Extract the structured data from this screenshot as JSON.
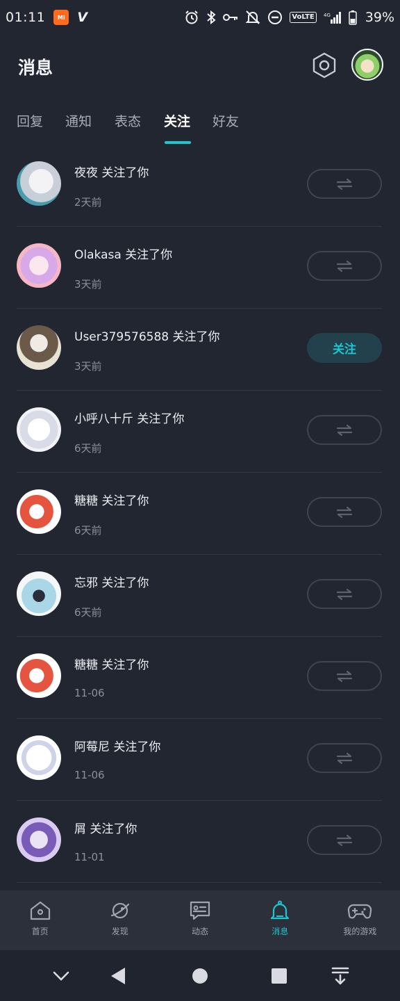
{
  "status_bar": {
    "time": "01:11",
    "app_badge": "Mi",
    "volte": "VoLTE",
    "network": "4G",
    "battery": "39%"
  },
  "header": {
    "title": "消息"
  },
  "tabs": [
    {
      "label": "回复"
    },
    {
      "label": "通知"
    },
    {
      "label": "表态"
    },
    {
      "label": "关注",
      "active": true
    },
    {
      "label": "好友"
    }
  ],
  "notifications": [
    {
      "name": "夜夜 关注了你",
      "time": "2天前",
      "button": "mutual",
      "avatar_color": "#c9cfd9"
    },
    {
      "name": "Olakasa 关注了你",
      "time": "3天前",
      "button": "mutual",
      "avatar_color": "#d8a9e8"
    },
    {
      "name": "User379576588 关注了你",
      "time": "3天前",
      "button": "follow",
      "button_label": "关注",
      "avatar_color": "#6b5a4a"
    },
    {
      "name": "小呼八十斤 关注了你",
      "time": "6天前",
      "button": "mutual",
      "avatar_color": "#e7e8f0"
    },
    {
      "name": "糖糖 关注了你",
      "time": "6天前",
      "button": "mutual",
      "avatar_color": "#e4543f"
    },
    {
      "name": "忘邪 关注了你",
      "time": "6天前",
      "button": "mutual",
      "avatar_color": "#a9d7e8"
    },
    {
      "name": "糖糖 关注了你",
      "time": "11-06",
      "button": "mutual",
      "avatar_color": "#e4543f"
    },
    {
      "name": "阿莓尼 关注了你",
      "time": "11-06",
      "button": "mutual",
      "avatar_color": "#e9ecf6"
    },
    {
      "name": "屑 关注了你",
      "time": "11-01",
      "button": "mutual",
      "avatar_color": "#7a5bb8"
    }
  ],
  "bottom_nav": [
    {
      "label": "首页",
      "icon": "home-icon"
    },
    {
      "label": "发现",
      "icon": "planet-icon"
    },
    {
      "label": "动态",
      "icon": "feed-icon"
    },
    {
      "label": "消息",
      "icon": "bell-icon",
      "active": true
    },
    {
      "label": "我的游戏",
      "icon": "gamepad-icon"
    }
  ],
  "colors": {
    "background": "#222631",
    "accent": "#1cc6d3",
    "nav_bg": "#2b303b"
  }
}
